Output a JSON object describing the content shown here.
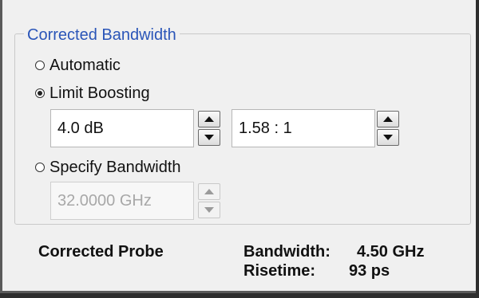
{
  "group": {
    "title": "Corrected Bandwidth",
    "options": {
      "automatic": {
        "label": "Automatic",
        "selected": false
      },
      "limit_boosting": {
        "label": "Limit Boosting",
        "selected": true,
        "value": "4.0 dB",
        "ratio": "1.58 : 1"
      },
      "specify_bandwidth": {
        "label": "Specify Bandwidth",
        "selected": false,
        "value": "32.0000 GHz",
        "enabled": false
      }
    }
  },
  "probe": {
    "label": "Corrected Probe",
    "bandwidth_label": "Bandwidth:",
    "bandwidth_value": "4.50 GHz",
    "risetime_label": "Risetime:",
    "risetime_value": "93 ps"
  },
  "colors": {
    "group_title": "#2a55b8",
    "panel_bg": "#f0f0f0",
    "disabled_text": "#a8a8a8"
  },
  "icons": {
    "spin_up": "triangle-up-icon",
    "spin_down": "triangle-down-icon"
  }
}
